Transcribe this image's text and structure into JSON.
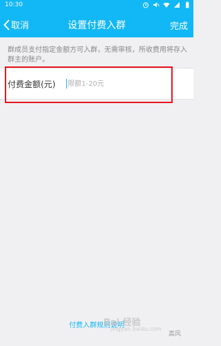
{
  "status_bar": {
    "time": "10:30",
    "icons": [
      "alarm-icon",
      "mute-icon",
      "wifi-icon",
      "signal-icon",
      "battery-icon"
    ]
  },
  "header": {
    "back_label": "取消",
    "title": "设置付费入群",
    "done_label": "完成"
  },
  "description": "群成员支付指定金额方可入群，无需审核，所收费用将存入群主的账户。",
  "amount_field": {
    "label": "付费金额(元)",
    "placeholder": "限额1-20元",
    "value": ""
  },
  "footer": {
    "rules_link": "付费入群规则说明"
  },
  "watermark": {
    "brand": "Bai 经验",
    "url": "jingyan.baidu.com",
    "author": "高风"
  },
  "colors": {
    "accent": "#12b7f5",
    "highlight": "#e8141b",
    "background": "#f0f0f3"
  }
}
